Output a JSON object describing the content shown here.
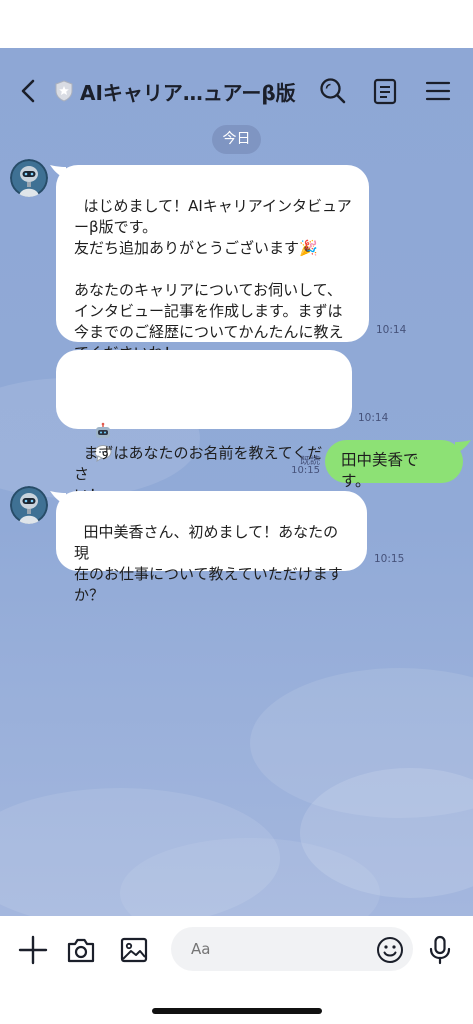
{
  "header": {
    "title": "AIキャリア…ュアーβ版",
    "icons": [
      "back-chevron-icon",
      "shield-badge-icon",
      "search-icon",
      "notes-icon",
      "menu-icon"
    ]
  },
  "date_separator": "今日",
  "messages": [
    {
      "from": "bot",
      "text": "はじめまして！AIキャリアインタビュア\nーβ版です。\n友だち追加ありがとうございます🎉\n\nあなたのキャリアについてお伺いして、\nインタビュー記事を作成します。まずは\n今までのご経歴についてかんたんに教え\nてくださいね！",
      "time": "10:14"
    },
    {
      "from": "bot",
      "prefix_icons": [
        "robot-emoji-icon",
        "speech-bubble-emoji-icon"
      ],
      "text": "まずはあなたのお名前を教えてくださ\nい！",
      "time": "10:14"
    },
    {
      "from": "user",
      "text": "田中美香です。",
      "read_label": "既読",
      "time": "10:15"
    },
    {
      "from": "bot",
      "text": "田中美香さん、初めまして！あなたの現\n在のお仕事について教えていただけます\nか？",
      "time": "10:15"
    }
  ],
  "composer": {
    "placeholder": "Aa",
    "icons": [
      "plus-icon",
      "camera-icon",
      "image-icon",
      "emoji-face-icon",
      "microphone-icon"
    ]
  },
  "colors": {
    "chat_background": "#8fa8d6",
    "bot_bubble": "#ffffff",
    "user_bubble": "#8de175",
    "date_chip": "#7f95c2"
  }
}
